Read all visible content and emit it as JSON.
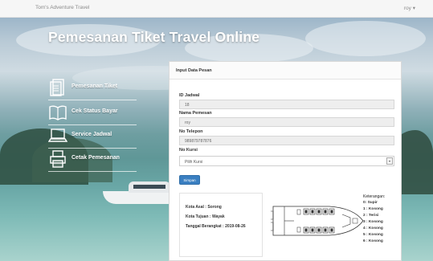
{
  "navbar": {
    "brand": "Tom's Adventure Travel",
    "user": "roy ▾"
  },
  "hero": {
    "title": "Pemesanan Tiket Travel Online"
  },
  "menu": {
    "items": [
      {
        "label": "Pemesanan Tiket",
        "icon": "document-icon"
      },
      {
        "label": "Cek Status Bayar",
        "icon": "book-icon"
      },
      {
        "label": "Service Jadwal",
        "icon": "laptop-icon"
      },
      {
        "label": "Cetak Pemesanan",
        "icon": "printer-icon"
      }
    ]
  },
  "form": {
    "title": "Input Data Pesan",
    "id_jadwal": {
      "label": "ID Jadwal",
      "value": "18"
    },
    "nama": {
      "label": "Nama Pemesan",
      "value": "roy"
    },
    "telepon": {
      "label": "No Telepon",
      "value": "989879787876"
    },
    "kursi": {
      "label": "No Kursi",
      "selected": "Pilih Kursi"
    },
    "submit_label": "Simpan"
  },
  "route": {
    "asal": "Kota Asal : Sorong",
    "tujuan": "Kota Tujuan : Wayak",
    "tanggal": "Tanggal Berangkat : 2019-08-26"
  },
  "legend": {
    "title": "Keterangan:",
    "items": [
      "0: Supir",
      "1 : Kosong",
      "2 : Terisi",
      "3 : Kosong",
      "4 : Kosong",
      "5 : Kosong",
      "6 : Kosong"
    ]
  },
  "colors": {
    "accent": "#3a7fc1",
    "panel_bg": "#ffffff",
    "input_bg": "#eeeeee"
  }
}
